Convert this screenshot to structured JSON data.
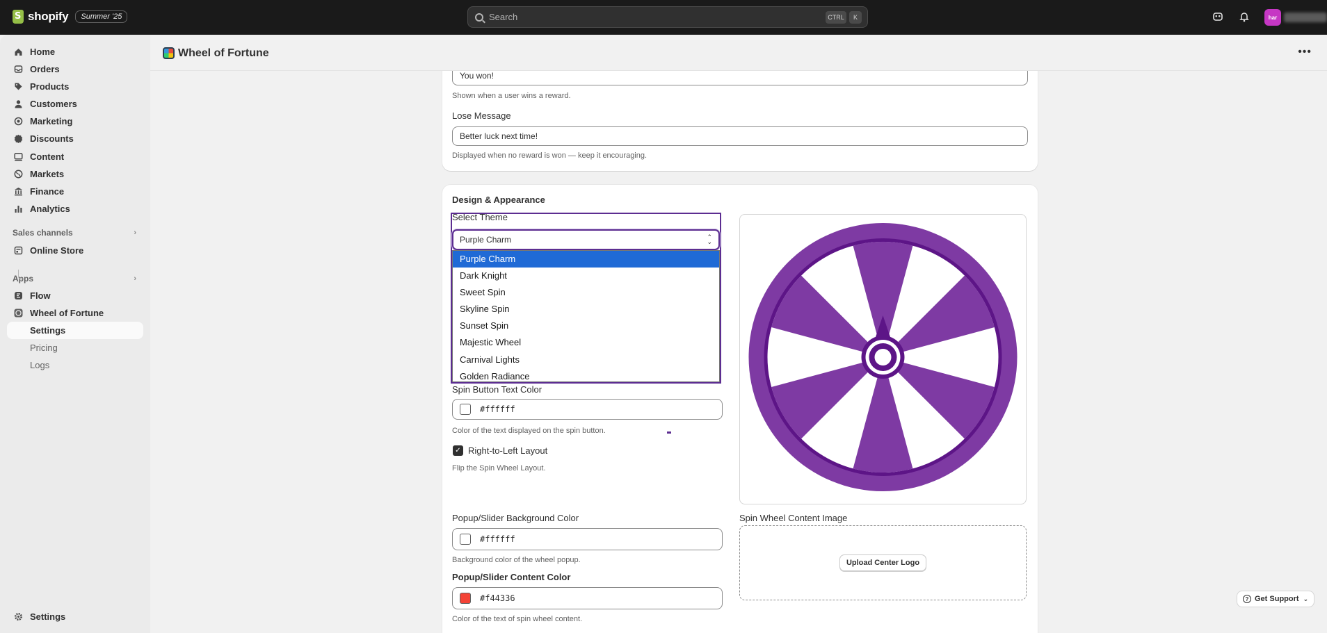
{
  "topbar": {
    "brand": "shopify",
    "edition_badge": "Summer '25",
    "search_placeholder": "Search",
    "shortcut_ctrl": "CTRL",
    "shortcut_k": "K",
    "avatar_initials": "har"
  },
  "sidebar": {
    "items": [
      {
        "label": "Home",
        "icon": "home-icon"
      },
      {
        "label": "Orders",
        "icon": "inbox-icon"
      },
      {
        "label": "Products",
        "icon": "tag-icon"
      },
      {
        "label": "Customers",
        "icon": "person-icon"
      },
      {
        "label": "Marketing",
        "icon": "target-icon"
      },
      {
        "label": "Discounts",
        "icon": "discount-icon"
      },
      {
        "label": "Content",
        "icon": "image-icon"
      },
      {
        "label": "Markets",
        "icon": "globe-icon"
      },
      {
        "label": "Finance",
        "icon": "bank-icon"
      },
      {
        "label": "Analytics",
        "icon": "bar-chart-icon"
      }
    ],
    "sales_channels_label": "Sales channels",
    "online_store": "Online Store",
    "apps_label": "Apps",
    "flow": "Flow",
    "wheel_app": "Wheel of Fortune",
    "app_subitems": [
      "Settings",
      "Pricing",
      "Logs"
    ],
    "settings": "Settings"
  },
  "page": {
    "title": "Wheel of Fortune"
  },
  "messages_card": {
    "win_value": "You won!",
    "win_help": "Shown when a user wins a reward.",
    "lose_label": "Lose Message",
    "lose_value": "Better luck next time!",
    "lose_help": "Displayed when no reward is won — keep it encouraging."
  },
  "design_card": {
    "title": "Design & Appearance",
    "theme_label": "Select Theme",
    "theme_value": "Purple Charm",
    "theme_options": [
      "Purple Charm",
      "Dark Knight",
      "Sweet Spin",
      "Skyline Spin",
      "Sunset Spin",
      "Majestic Wheel",
      "Carnival Lights",
      "Golden Radiance"
    ],
    "spin_text_label": "Spin Button Text Color",
    "spin_text_value": "#ffffff",
    "spin_text_help": "Color of the text displayed on the spin button.",
    "rtl_label": "Right-to-Left Layout",
    "rtl_checked": true,
    "rtl_help": "Flip the Spin Wheel Layout.",
    "popup_bg_label": "Popup/Slider Background Color",
    "popup_bg_value": "#ffffff",
    "popup_bg_help": "Background color of the wheel popup.",
    "popup_content_label": "Popup/Slider Content Color",
    "popup_content_value": "#f44336",
    "popup_content_help": "Color of the text of spin wheel content.",
    "content_image_label": "Spin Wheel Content Image",
    "upload_button": "Upload Center Logo"
  },
  "support": {
    "label": "Get Support"
  },
  "colors": {
    "wheel_purple": "#7e3aa3",
    "wheel_dark_purple": "#5d1587",
    "selected_option": "#1f6ad6",
    "content_swatch": "#f44336"
  }
}
